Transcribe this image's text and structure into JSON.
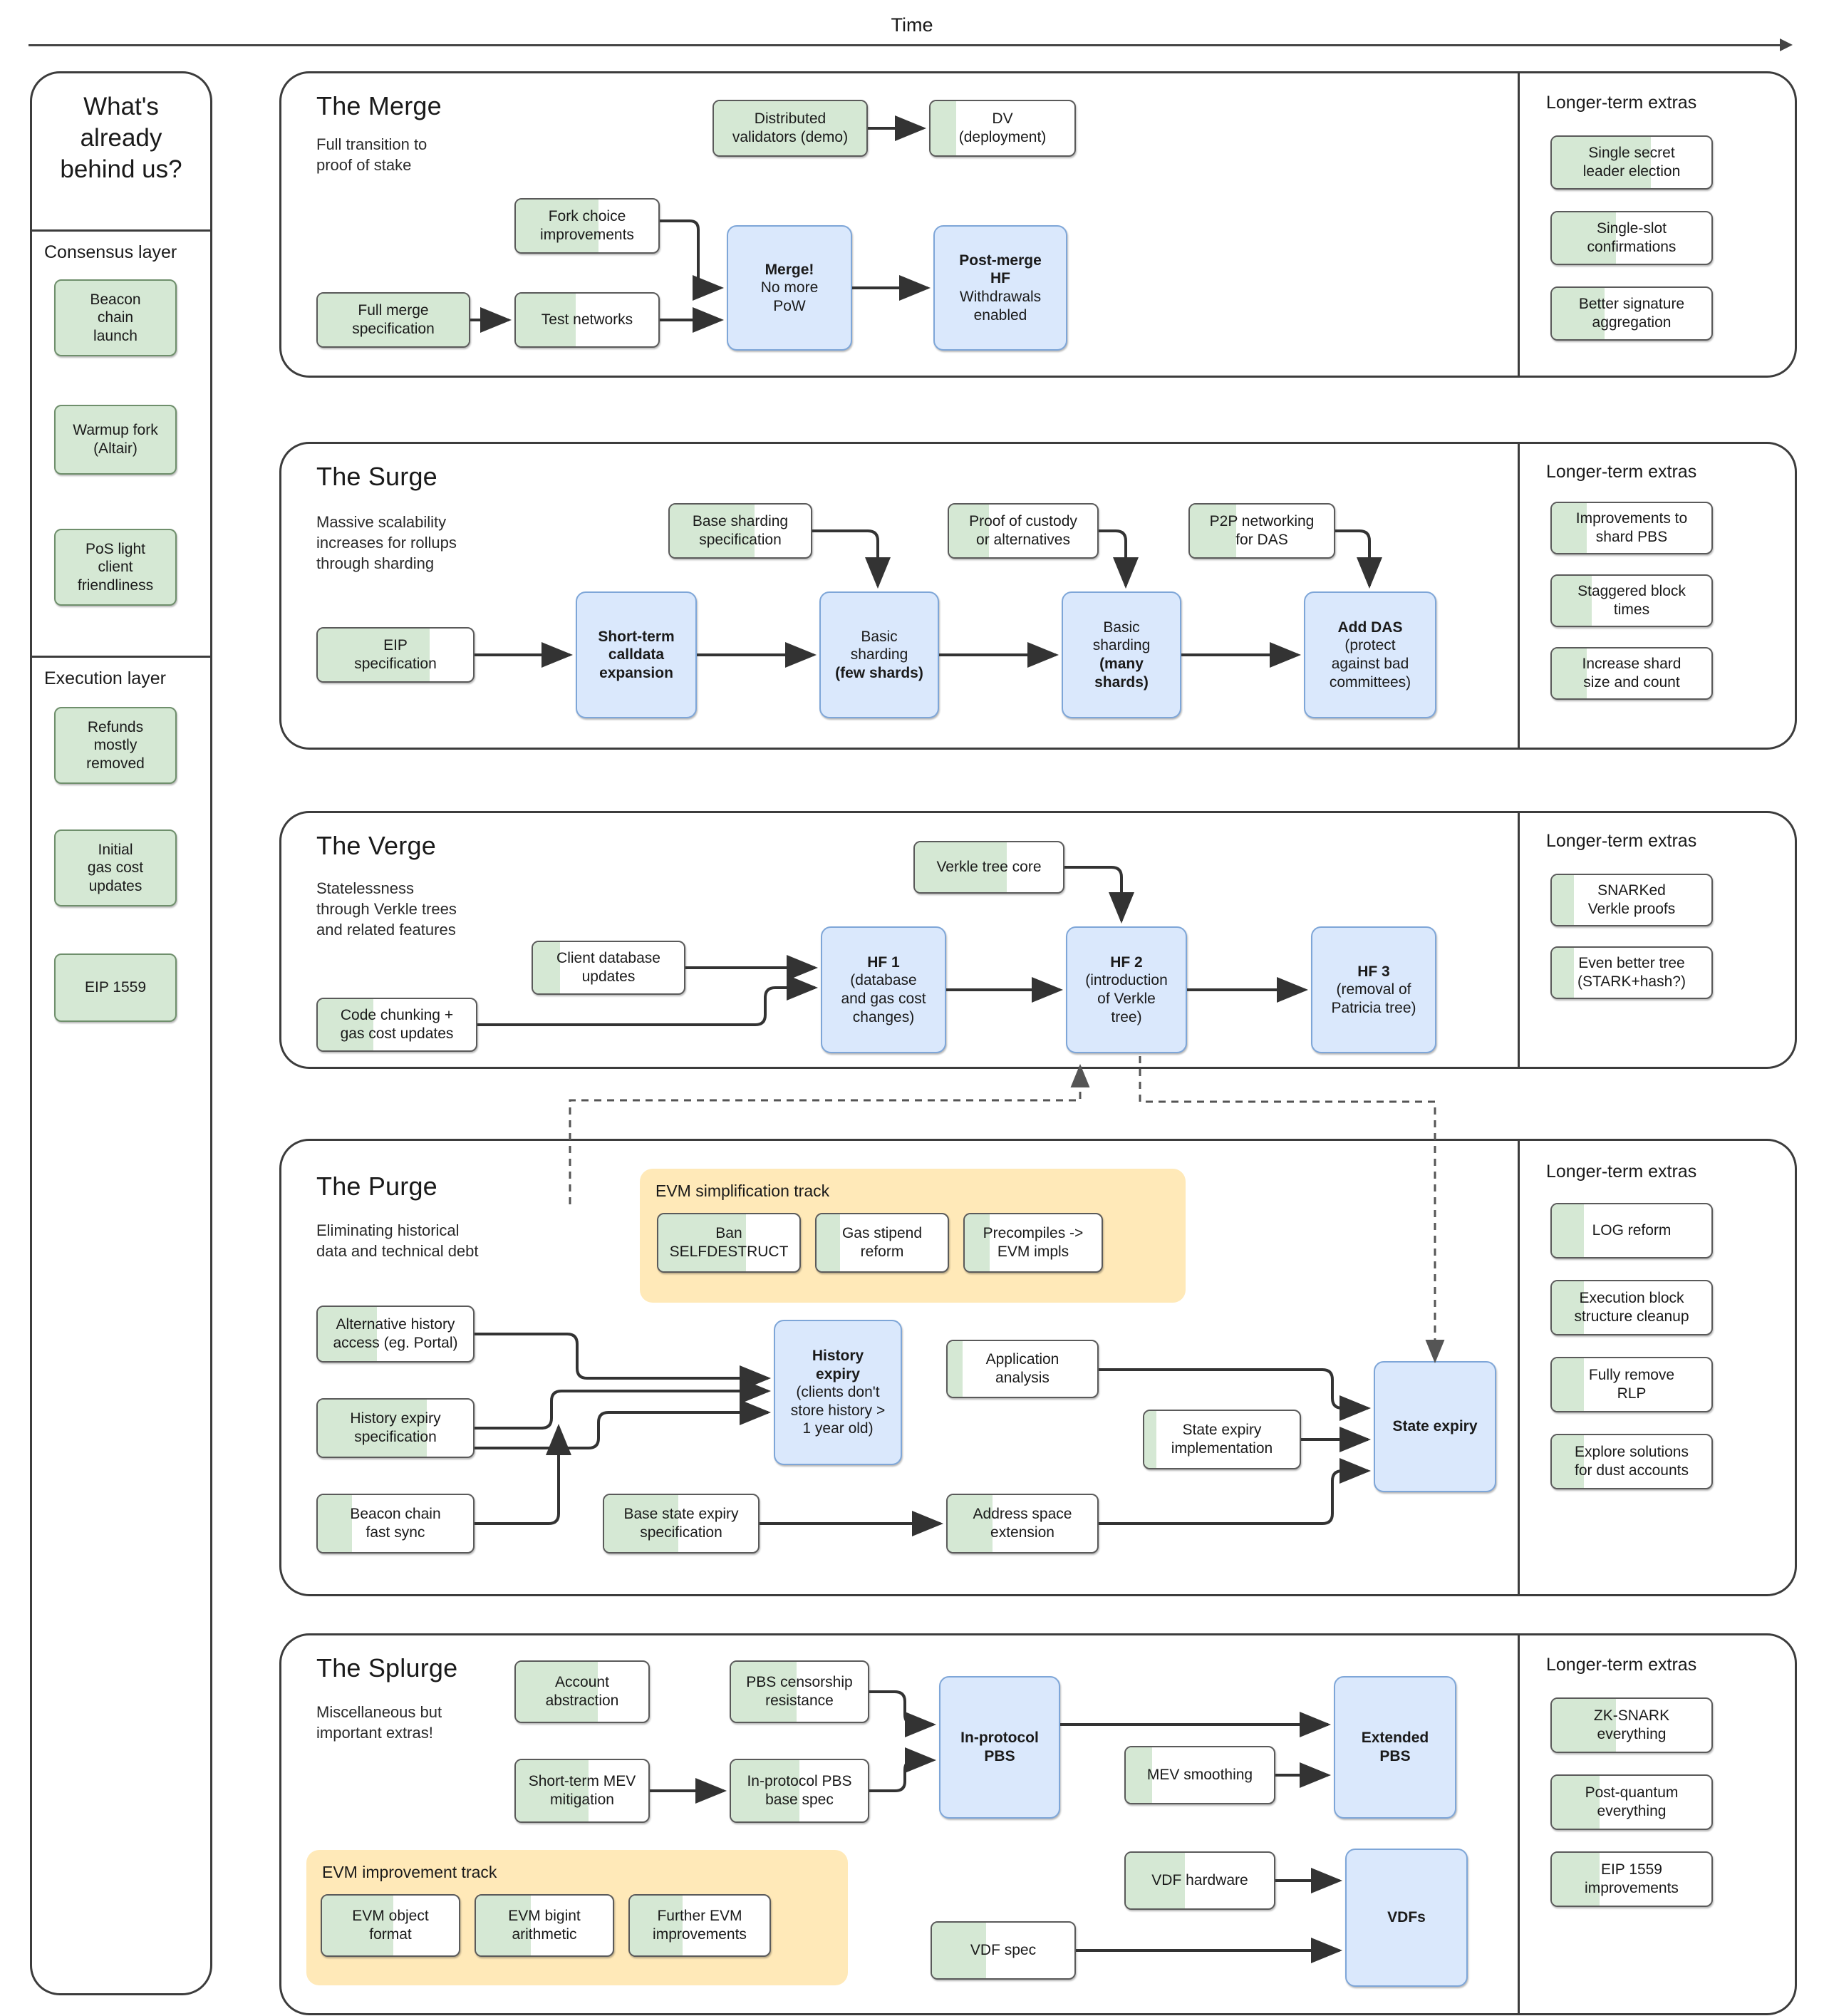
{
  "colors": {
    "green": "#d5e8d4",
    "blue": "#dae8fc",
    "orange": "#ffe9b8",
    "stroke": "#3c3c3c"
  },
  "axis": {
    "label": "Time"
  },
  "sidebar": {
    "heading": "What's\nalready\nbehind us?",
    "heading_lines": [
      "What's",
      "already",
      "behind us?"
    ],
    "groups": [
      {
        "label": "Consensus layer",
        "items": [
          {
            "lines": [
              "Beacon",
              "chain",
              "launch"
            ]
          },
          {
            "lines": [
              "Warmup fork",
              "(Altair)"
            ]
          },
          {
            "lines": [
              "PoS light",
              "client",
              "friendliness"
            ]
          }
        ]
      },
      {
        "label": "Execution layer",
        "items": [
          {
            "lines": [
              "Refunds",
              "mostly",
              "removed"
            ]
          },
          {
            "lines": [
              "Initial",
              "gas cost",
              "updates"
            ]
          },
          {
            "lines": [
              "EIP 1559"
            ]
          }
        ]
      }
    ]
  },
  "extras_heading": "Longer-term extras",
  "sections": [
    {
      "id": "merge",
      "title": "The Merge",
      "subtitle": [
        "Full transition to",
        "proof of stake"
      ],
      "nodes": [
        {
          "id": "dist-val",
          "lines": [
            "Distributed",
            "validators (demo)"
          ],
          "type": "green",
          "progress": 100
        },
        {
          "id": "dv-deploy",
          "lines": [
            "DV",
            "(deployment)"
          ],
          "type": "green",
          "progress": 18
        },
        {
          "id": "fork-choice",
          "lines": [
            "Fork choice",
            "improvements"
          ],
          "type": "green",
          "progress": 58
        },
        {
          "id": "full-merge-spec",
          "lines": [
            "Full merge",
            "specification"
          ],
          "type": "solid-green",
          "progress": 100
        },
        {
          "id": "test-nets",
          "lines": [
            "Test networks"
          ],
          "type": "green",
          "progress": 42
        },
        {
          "id": "merge",
          "lines": [
            "Merge!",
            "No more",
            "PoW"
          ],
          "type": "blue",
          "bold_lines": [
            0
          ]
        },
        {
          "id": "post-merge-hf",
          "lines": [
            "Post-merge",
            "HF",
            "Withdrawals",
            "enabled"
          ],
          "type": "blue",
          "bold_lines": [
            0,
            1
          ]
        }
      ],
      "extras": [
        {
          "lines": [
            "Single secret",
            "leader election"
          ],
          "progress": 62
        },
        {
          "lines": [
            "Single-slot",
            "confirmations"
          ],
          "progress": 40
        },
        {
          "lines": [
            "Better signature",
            "aggregation"
          ],
          "progress": 33
        }
      ]
    },
    {
      "id": "surge",
      "title": "The Surge",
      "subtitle": [
        "Massive scalability",
        "increases for rollups",
        "through sharding"
      ],
      "nodes": [
        {
          "id": "base-shard-spec",
          "lines": [
            "Base sharding",
            "specification"
          ],
          "type": "green",
          "progress": 60
        },
        {
          "id": "proof-custody",
          "lines": [
            "Proof of custody",
            "or alternatives"
          ],
          "type": "green",
          "progress": 27
        },
        {
          "id": "p2p-das",
          "lines": [
            "P2P networking",
            "for DAS"
          ],
          "type": "green",
          "progress": 32
        },
        {
          "id": "eip-spec",
          "lines": [
            "EIP",
            "specification"
          ],
          "type": "green",
          "progress": 72
        },
        {
          "id": "calldata",
          "lines": [
            "Short-term",
            "calldata",
            "expansion"
          ],
          "type": "blue",
          "bold_lines": [
            0,
            1,
            2
          ]
        },
        {
          "id": "basic-few",
          "lines": [
            "Basic",
            "sharding",
            "(few shards)"
          ],
          "type": "blue",
          "bold_lines": [
            2
          ]
        },
        {
          "id": "basic-many",
          "lines": [
            "Basic",
            "sharding",
            "(many",
            "shards)"
          ],
          "type": "blue",
          "bold_lines": [
            2,
            3
          ]
        },
        {
          "id": "add-das",
          "lines": [
            "Add DAS",
            "(protect",
            "against bad",
            "committees)"
          ],
          "type": "blue",
          "bold_lines": [
            0
          ]
        }
      ],
      "extras": [
        {
          "lines": [
            "Improvements to",
            "shard PBS"
          ],
          "progress": 22
        },
        {
          "lines": [
            "Staggered block",
            "times"
          ],
          "progress": 25
        },
        {
          "lines": [
            "Increase shard",
            "size and count"
          ],
          "progress": 22
        }
      ]
    },
    {
      "id": "verge",
      "title": "The Verge",
      "subtitle": [
        "Statelessness",
        "through Verkle trees",
        "and related features"
      ],
      "nodes": [
        {
          "id": "verkle-core",
          "lines": [
            "Verkle tree core"
          ],
          "type": "green",
          "progress": 62
        },
        {
          "id": "client-db",
          "lines": [
            "Client database",
            "updates"
          ],
          "type": "green",
          "progress": 18
        },
        {
          "id": "code-chunk",
          "lines": [
            "Code chunking +",
            "gas cost updates"
          ],
          "type": "green",
          "progress": 35
        },
        {
          "id": "hf1",
          "lines": [
            "HF 1",
            "(database",
            "and gas cost",
            "changes)"
          ],
          "type": "blue",
          "bold_lines": [
            0
          ]
        },
        {
          "id": "hf2",
          "lines": [
            "HF 2",
            "(introduction",
            "of Verkle",
            "tree)"
          ],
          "type": "blue",
          "bold_lines": [
            0
          ]
        },
        {
          "id": "hf3",
          "lines": [
            "HF 3",
            "(removal of",
            "Patricia tree)"
          ],
          "type": "blue",
          "bold_lines": [
            0
          ]
        }
      ],
      "extras": [
        {
          "lines": [
            "SNARKed",
            "Verkle proofs"
          ],
          "progress": 14
        },
        {
          "lines": [
            "Even better tree",
            "(STARK+hash?)"
          ],
          "progress": 14
        }
      ]
    },
    {
      "id": "purge",
      "title": "The Purge",
      "subtitle": [
        "Eliminating historical",
        "data and technical debt"
      ],
      "track": {
        "label": "EVM simplification track",
        "items": [
          {
            "lines": [
              "Ban",
              "SELFDESTRUCT"
            ],
            "progress": 62
          },
          {
            "lines": [
              "Gas stipend",
              "reform"
            ],
            "progress": 18
          },
          {
            "lines": [
              "Precompiles ->",
              "EVM impls"
            ],
            "progress": 18
          }
        ]
      },
      "nodes": [
        {
          "id": "alt-history",
          "lines": [
            "Alternative history",
            "access (eg. Portal)"
          ],
          "type": "green",
          "progress": 38
        },
        {
          "id": "hist-expiry-spec",
          "lines": [
            "History expiry",
            "specification"
          ],
          "type": "green",
          "progress": 70
        },
        {
          "id": "beacon-fast-sync",
          "lines": [
            "Beacon chain",
            "fast sync"
          ],
          "type": "green",
          "progress": 22
        },
        {
          "id": "history-expiry",
          "lines": [
            "History",
            "expiry",
            "(clients don't",
            "store history >",
            "1 year old)"
          ],
          "type": "blue",
          "bold_lines": [
            0,
            1
          ]
        },
        {
          "id": "app-analysis",
          "lines": [
            "Application",
            "analysis"
          ],
          "type": "green",
          "progress": 10
        },
        {
          "id": "state-expiry-impl",
          "lines": [
            "State expiry",
            "implementation"
          ],
          "type": "green",
          "progress": 8
        },
        {
          "id": "base-state-spec",
          "lines": [
            "Base state expiry",
            "specification"
          ],
          "type": "green",
          "progress": 48
        },
        {
          "id": "addr-space",
          "lines": [
            "Address space",
            "extension"
          ],
          "type": "green",
          "progress": 30
        },
        {
          "id": "state-expiry",
          "lines": [
            "State expiry"
          ],
          "type": "blue",
          "bold_lines": [
            0
          ]
        }
      ],
      "extras": [
        {
          "lines": [
            "LOG reform"
          ],
          "progress": 20
        },
        {
          "lines": [
            "Execution block",
            "structure cleanup"
          ],
          "progress": 20
        },
        {
          "lines": [
            "Fully remove",
            "RLP"
          ],
          "progress": 20
        },
        {
          "lines": [
            "Explore solutions",
            "for dust accounts"
          ],
          "progress": 20
        }
      ]
    },
    {
      "id": "splurge",
      "title": "The Splurge",
      "subtitle": [
        "Miscellaneous but",
        "important extras!"
      ],
      "track": {
        "label": "EVM improvement track",
        "items": [
          {
            "lines": [
              "EVM object",
              "format"
            ],
            "progress": 52
          },
          {
            "lines": [
              "EVM bigint",
              "arithmetic"
            ],
            "progress": 40
          },
          {
            "lines": [
              "Further EVM",
              "improvements"
            ],
            "progress": 38
          }
        ]
      },
      "nodes": [
        {
          "id": "account-abs",
          "lines": [
            "Account",
            "abstraction"
          ],
          "type": "green",
          "progress": 62
        },
        {
          "id": "pbs-censor",
          "lines": [
            "PBS censorship",
            "resistance"
          ],
          "type": "green",
          "progress": 48
        },
        {
          "id": "short-mev",
          "lines": [
            "Short-term MEV",
            "mitigation"
          ],
          "type": "green",
          "progress": 55
        },
        {
          "id": "pbs-base-spec",
          "lines": [
            "In-protocol PBS",
            "base spec"
          ],
          "type": "green",
          "progress": 50
        },
        {
          "id": "in-protocol-pbs",
          "lines": [
            "In-protocol",
            "PBS"
          ],
          "type": "blue",
          "bold_lines": [
            0,
            1
          ]
        },
        {
          "id": "mev-smoothing",
          "lines": [
            "MEV smoothing"
          ],
          "type": "green",
          "progress": 18
        },
        {
          "id": "extended-pbs",
          "lines": [
            "Extended",
            "PBS"
          ],
          "type": "blue",
          "bold_lines": [
            0,
            1
          ]
        },
        {
          "id": "vdf-hardware",
          "lines": [
            "VDF hardware"
          ],
          "type": "green",
          "progress": 40
        },
        {
          "id": "vdf-spec",
          "lines": [
            "VDF spec"
          ],
          "type": "green",
          "progress": 38
        },
        {
          "id": "vdfs",
          "lines": [
            "VDFs"
          ],
          "type": "blue",
          "bold_lines": [
            0
          ]
        }
      ],
      "extras": [
        {
          "lines": [
            "ZK-SNARK",
            "everything"
          ],
          "progress": 40
        },
        {
          "lines": [
            "Post-quantum",
            "everything"
          ],
          "progress": 30
        },
        {
          "lines": [
            "EIP 1559",
            "improvements"
          ],
          "progress": 30
        }
      ]
    }
  ]
}
